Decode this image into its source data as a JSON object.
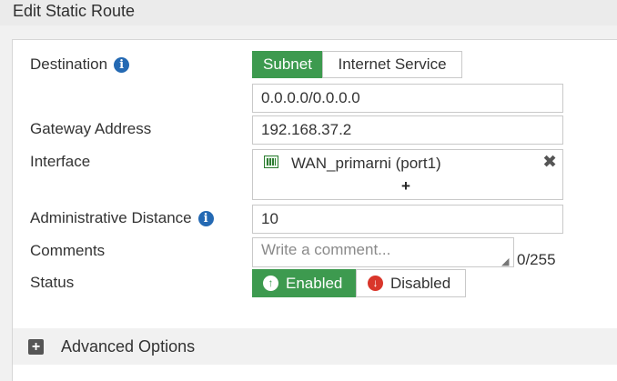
{
  "header": {
    "title": "Edit Static Route"
  },
  "form": {
    "destination": {
      "label": "Destination",
      "options": [
        "Subnet",
        "Internet Service"
      ],
      "selected": "Subnet",
      "value": "0.0.0.0/0.0.0.0"
    },
    "gateway": {
      "label": "Gateway Address",
      "value": "192.168.37.2"
    },
    "interface": {
      "label": "Interface",
      "value": "WAN_primarni (port1)",
      "add_symbol": "+",
      "remove_symbol": "✖"
    },
    "admin_distance": {
      "label": "Administrative Distance",
      "value": "10"
    },
    "comments": {
      "label": "Comments",
      "placeholder": "Write a comment...",
      "counter": "0/255"
    },
    "status": {
      "label": "Status",
      "options": [
        "Enabled",
        "Disabled"
      ],
      "selected": "Enabled"
    }
  },
  "advanced": {
    "label": "Advanced Options"
  },
  "icons": {
    "info": "info-icon",
    "port": "port-icon",
    "remove": "close-icon",
    "add": "plus-icon",
    "enabled": "arrow-up-circle-icon",
    "disabled": "arrow-down-circle-icon",
    "expand": "plus-square-icon"
  },
  "colors": {
    "accent_green": "#3d9a4f",
    "disabled_red": "#d9362b",
    "info_blue": "#2469b3"
  }
}
